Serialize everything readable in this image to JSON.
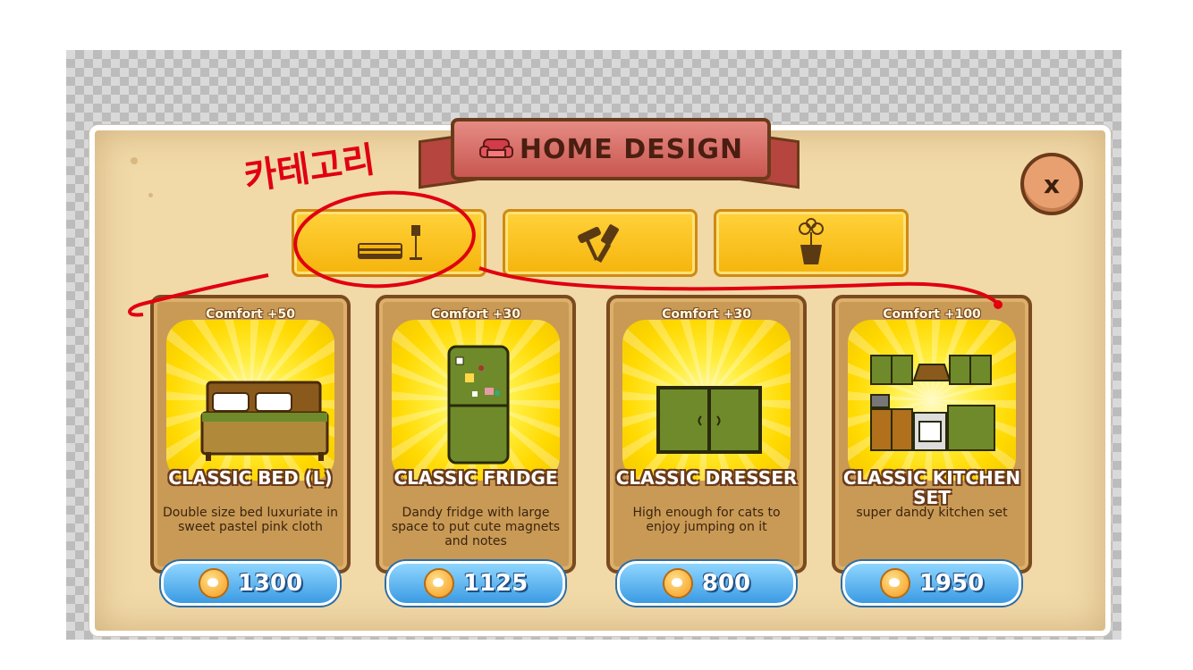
{
  "title": "HOME DESIGN",
  "close_label": "x",
  "tabs": [
    {
      "name": "furniture",
      "icon": "bed-lamp-icon"
    },
    {
      "name": "decor",
      "icon": "roller-brush-icon"
    },
    {
      "name": "plants",
      "icon": "flower-pot-icon"
    }
  ],
  "items": [
    {
      "comfort": "Comfort +50",
      "name": "CLASSIC BED (L)",
      "desc": "Double size bed luxuriate in sweet pastel pink cloth",
      "price": "1300",
      "icon": "bed-icon"
    },
    {
      "comfort": "Comfort +30",
      "name": "CLASSIC FRIDGE",
      "desc": "Dandy fridge with large space to put cute magnets and notes",
      "price": "1125",
      "icon": "fridge-icon"
    },
    {
      "comfort": "Comfort +30",
      "name": "CLASSIC DRESSER",
      "desc": "High enough for cats to enjoy jumping on it",
      "price": "800",
      "icon": "dresser-icon"
    },
    {
      "comfort": "Comfort +100",
      "name": "CLASSIC KITCHEN SET",
      "desc": "super dandy kitchen set",
      "price": "1950",
      "icon": "kitchen-set-icon"
    }
  ],
  "annotation": "카테고리",
  "colors": {
    "accent": "#f5b40c",
    "annotation": "#e00010",
    "price_button": "#3b9be3"
  }
}
